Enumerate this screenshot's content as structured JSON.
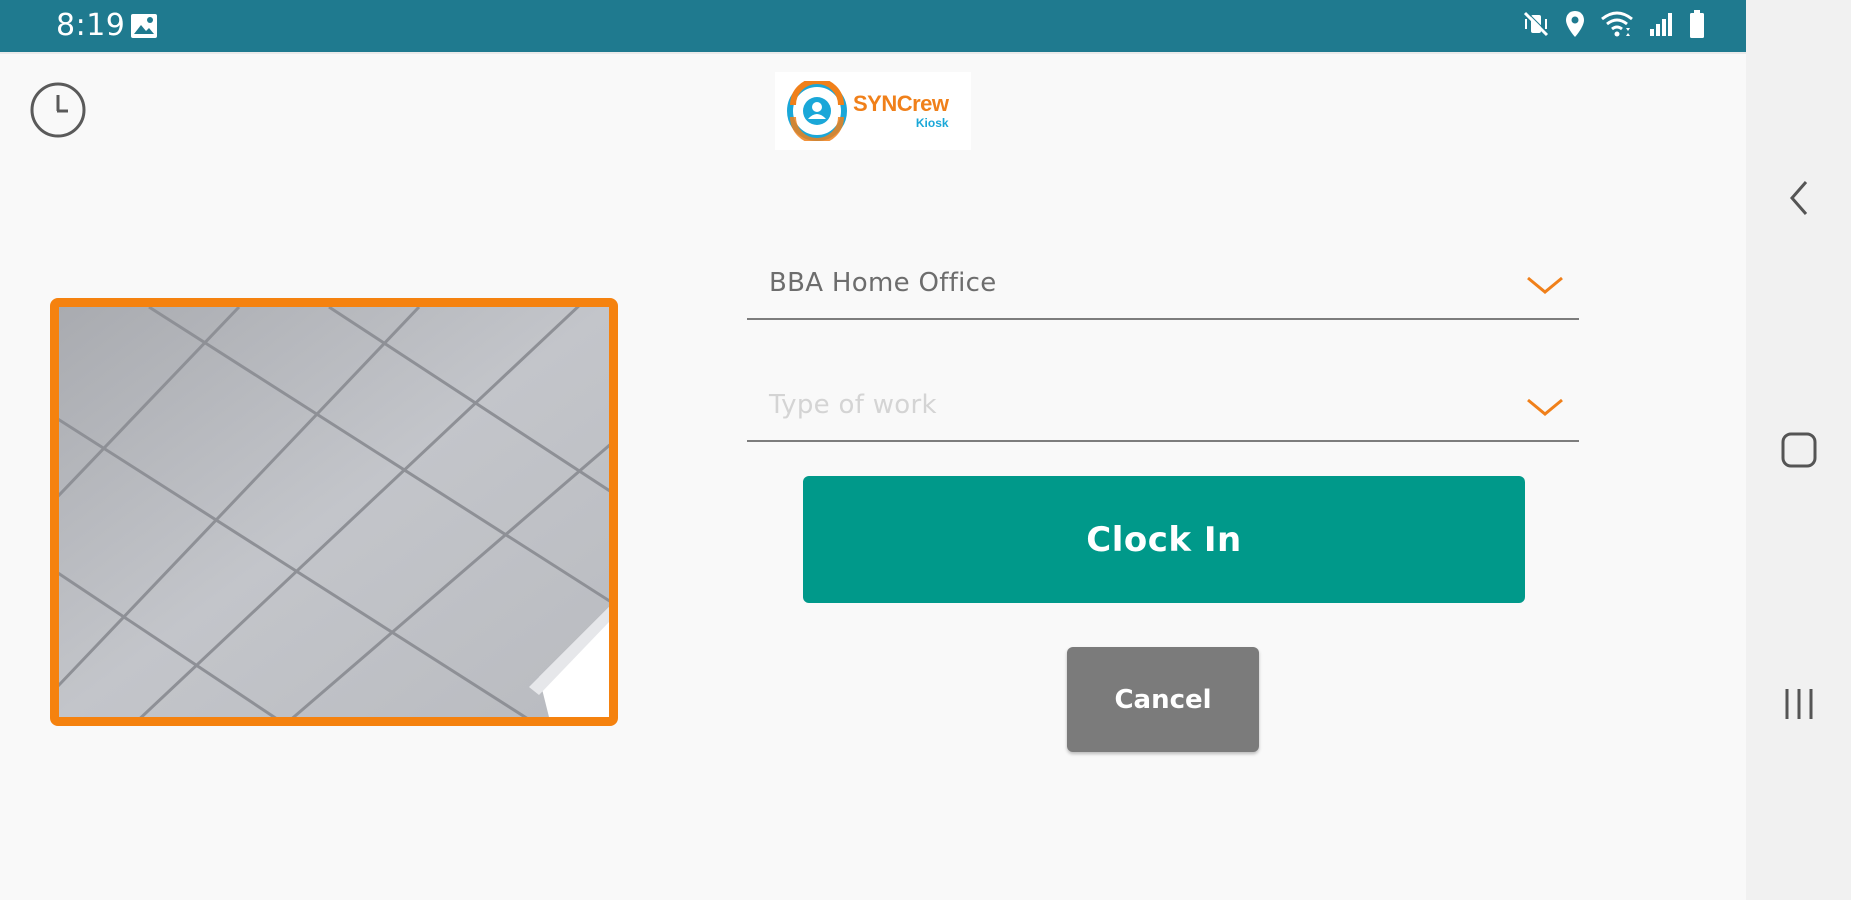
{
  "status_bar": {
    "time": "8:19",
    "icons": [
      "gallery-icon",
      "mute-vibrate-icon",
      "location-icon",
      "wifi-icon",
      "signal-icon",
      "battery-icon"
    ]
  },
  "header": {
    "history_icon": "clock-icon",
    "logo": {
      "brand": "SYNCrew",
      "sub": "Kiosk"
    }
  },
  "form": {
    "location_value": "BBA Home Office",
    "work_type_placeholder": "Type of work",
    "clock_in_label": "Clock In",
    "cancel_label": "Cancel"
  },
  "nav_bar": {
    "items": [
      "back-icon",
      "home-icon",
      "recents-icon"
    ]
  },
  "colors": {
    "status_bar": "#1f7a8f",
    "accent_orange": "#f5820f",
    "clock_in": "#00998a",
    "cancel": "#7b7b7b"
  }
}
